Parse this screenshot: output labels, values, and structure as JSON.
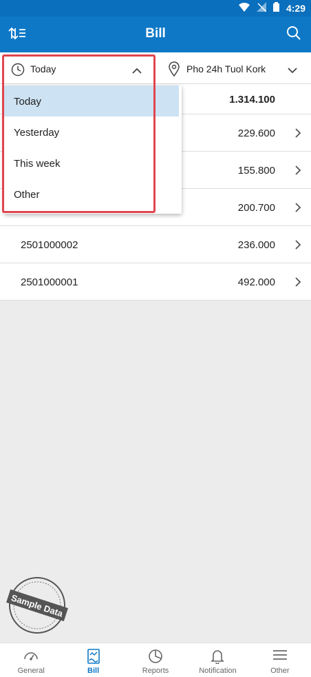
{
  "status_bar": {
    "time": "4:29"
  },
  "app_bar": {
    "title": "Bill"
  },
  "filters": {
    "date_label": "Today",
    "branch_label": "Pho 24h Tuol Kork"
  },
  "date_dropdown": {
    "options": [
      {
        "label": "Today",
        "selected": true
      },
      {
        "label": "Yesterday"
      },
      {
        "label": "This week"
      },
      {
        "label": "Other"
      }
    ]
  },
  "bills": {
    "total": "1.314.100",
    "rows": [
      {
        "code": "",
        "amount": "229.600"
      },
      {
        "code": "",
        "amount": "155.800"
      },
      {
        "code": "",
        "amount": "200.700"
      },
      {
        "code": "2501000002",
        "amount": "236.000"
      },
      {
        "code": "2501000001",
        "amount": "492.000"
      }
    ]
  },
  "watermark": "Sample Data",
  "bottom_nav": {
    "items": [
      {
        "label": "General",
        "icon": "gauge-icon"
      },
      {
        "label": "Bill",
        "icon": "bill-icon",
        "active": true
      },
      {
        "label": "Reports",
        "icon": "pie-chart-icon"
      },
      {
        "label": "Notification",
        "icon": "bell-icon"
      },
      {
        "label": "Other",
        "icon": "menu-icon"
      }
    ]
  },
  "colors": {
    "primary": "#0e78c7",
    "status_bar": "#0a6fbd",
    "selected_option": "#cde2f2",
    "highlight": "#e0454f"
  }
}
